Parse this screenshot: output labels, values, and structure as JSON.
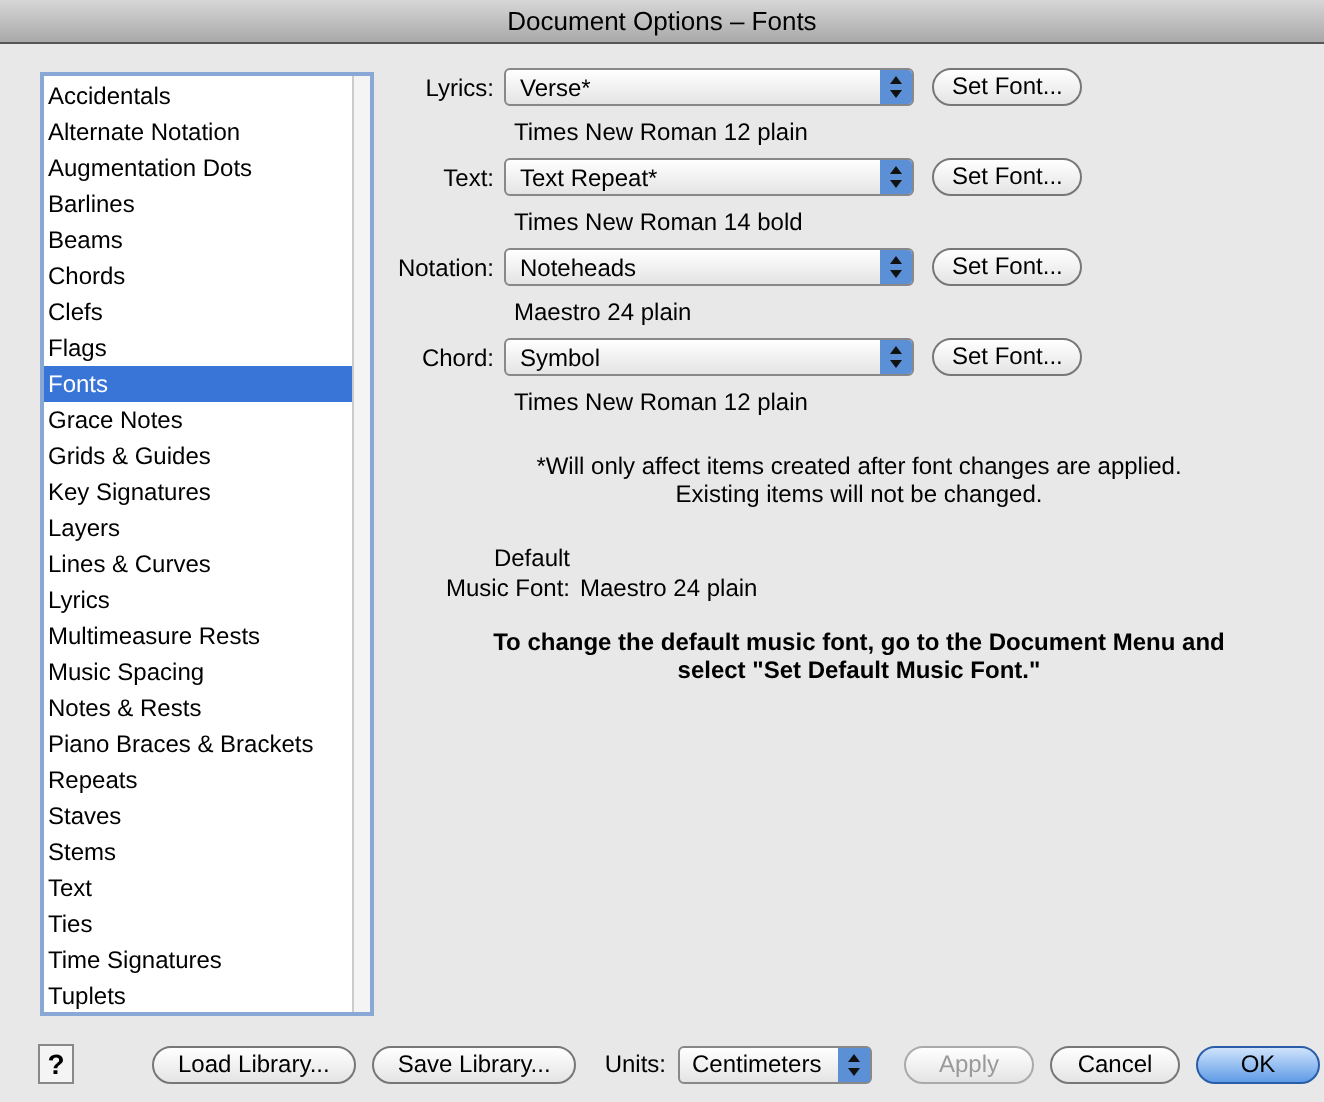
{
  "window": {
    "title": "Document Options – Fonts"
  },
  "sidebar": {
    "items": [
      {
        "label": "Accidentals",
        "selected": false
      },
      {
        "label": "Alternate Notation",
        "selected": false
      },
      {
        "label": "Augmentation Dots",
        "selected": false
      },
      {
        "label": "Barlines",
        "selected": false
      },
      {
        "label": "Beams",
        "selected": false
      },
      {
        "label": "Chords",
        "selected": false
      },
      {
        "label": "Clefs",
        "selected": false
      },
      {
        "label": "Flags",
        "selected": false
      },
      {
        "label": "Fonts",
        "selected": true
      },
      {
        "label": "Grace Notes",
        "selected": false
      },
      {
        "label": "Grids & Guides",
        "selected": false
      },
      {
        "label": "Key Signatures",
        "selected": false
      },
      {
        "label": "Layers",
        "selected": false
      },
      {
        "label": "Lines & Curves",
        "selected": false
      },
      {
        "label": "Lyrics",
        "selected": false
      },
      {
        "label": "Multimeasure Rests",
        "selected": false
      },
      {
        "label": "Music Spacing",
        "selected": false
      },
      {
        "label": "Notes & Rests",
        "selected": false
      },
      {
        "label": "Piano Braces & Brackets",
        "selected": false
      },
      {
        "label": "Repeats",
        "selected": false
      },
      {
        "label": "Staves",
        "selected": false
      },
      {
        "label": "Stems",
        "selected": false
      },
      {
        "label": "Text",
        "selected": false
      },
      {
        "label": "Ties",
        "selected": false
      },
      {
        "label": "Time Signatures",
        "selected": false
      },
      {
        "label": "Tuplets",
        "selected": false
      }
    ]
  },
  "font_rows": [
    {
      "label": "Lyrics:",
      "value": "Verse*",
      "button": "Set Font...",
      "font": "Times New Roman 12 plain"
    },
    {
      "label": "Text:",
      "value": "Text Repeat*",
      "button": "Set Font...",
      "font": "Times New Roman 14 bold"
    },
    {
      "label": "Notation:",
      "value": "Noteheads",
      "button": "Set Font...",
      "font": "Maestro 24 plain"
    },
    {
      "label": "Chord:",
      "value": "Symbol",
      "button": "Set Font...",
      "font": "Times New Roman 12 plain"
    }
  ],
  "note": [
    "*Will only affect items created after font changes are applied.",
    "Existing items will not be changed."
  ],
  "default_font": {
    "label_1": "Default",
    "label_2": "Music Font:",
    "value": "Maestro 24 plain"
  },
  "instruction": [
    "To change the default music font, go to the Document Menu and",
    "select \"Set Default Music Font.\""
  ],
  "footer": {
    "help": "?",
    "load": "Load Library...",
    "save": "Save Library...",
    "units_label": "Units:",
    "units": "Centimeters",
    "buttons": [
      {
        "label": "Apply",
        "disabled": true,
        "default": false
      },
      {
        "label": "Cancel",
        "disabled": false,
        "default": false
      },
      {
        "label": "OK",
        "disabled": false,
        "default": true
      }
    ]
  }
}
